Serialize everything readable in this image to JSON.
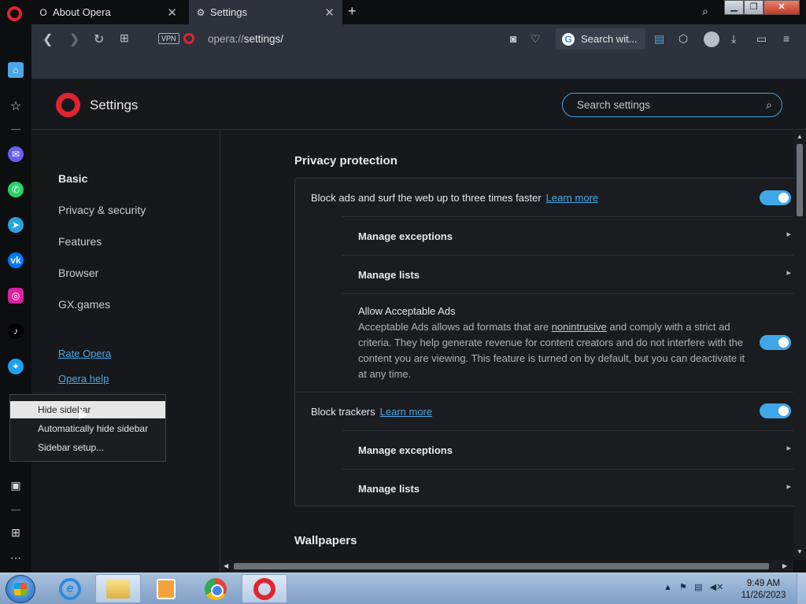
{
  "tabs": [
    {
      "label": "About Opera",
      "active": false
    },
    {
      "label": "Settings",
      "active": true
    }
  ],
  "address": {
    "scheme": "opera://",
    "path": "settings/",
    "vpn_label": "VPN",
    "search_label": "Search wit..."
  },
  "header": {
    "title": "Settings",
    "search_placeholder": "Search settings"
  },
  "nav": {
    "items": [
      "Basic",
      "Privacy & security",
      "Features",
      "Browser",
      "GX.games"
    ],
    "links": [
      "Rate Opera",
      "Opera help"
    ]
  },
  "context_menu": {
    "items": [
      "Hide sidebar",
      "Automatically hide sidebar",
      "Sidebar setup..."
    ],
    "highlighted": "Hide sidebar"
  },
  "privacy": {
    "title": "Privacy protection",
    "block_ads_label": "Block ads and surf the web up to three times faster",
    "learn_more": "Learn more",
    "block_ads_enabled": true,
    "manage_exceptions": "Manage exceptions",
    "manage_lists": "Manage lists",
    "acceptable_ads_title": "Allow Acceptable Ads",
    "acceptable_ads_desc_1": "Acceptable Ads allows ad formats that are",
    "acceptable_ads_desc_link": "nonintrusive",
    "acceptable_ads_desc_2": "and comply with a strict ad criteria. They help generate revenue for content creators and do not interfere with the content you are viewing. This feature is turned on by default, but you can deactivate it at any time.",
    "acceptable_ads_enabled": true,
    "block_trackers_label": "Block trackers",
    "block_trackers_enabled": true
  },
  "wallpapers": {
    "title": "Wallpapers"
  },
  "taskbar": {
    "time": "9:49 AM",
    "date": "11/26/2023"
  },
  "colors": {
    "accent": "#3fa7e8",
    "opera_red": "#e0252f",
    "bg": "#16181c"
  }
}
